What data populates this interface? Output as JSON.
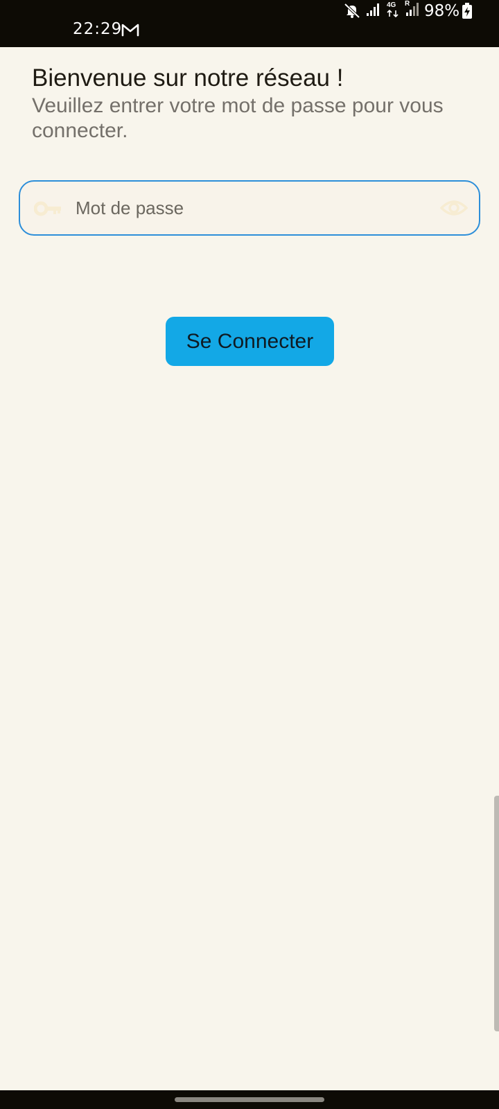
{
  "status_bar": {
    "time": "22:29",
    "notification_icons": [
      "gmail-icon"
    ],
    "system_icons": [
      "mute-icon",
      "signal-icon",
      "lte-icon",
      "signal-icon"
    ],
    "network_type": "4G",
    "roaming_indicator": "R",
    "battery": "98%"
  },
  "header": {
    "title": "Bienvenue sur notre réseau !",
    "subtitle": "Veuillez entrer votre mot de passe pour vous connecter."
  },
  "password_field": {
    "placeholder": "Mot de passe",
    "value": "",
    "leading_icon": "key-icon",
    "trailing_icon": "eye-icon",
    "border_color": "#2c8ed9"
  },
  "connect_button": {
    "label": "Se Connecter",
    "background_color": "#13a8e6"
  },
  "colors": {
    "background": "#f8f5ec",
    "status_bar": "#0d0b05",
    "title_text": "#1f1b13",
    "subtitle_text": "#74706a"
  }
}
